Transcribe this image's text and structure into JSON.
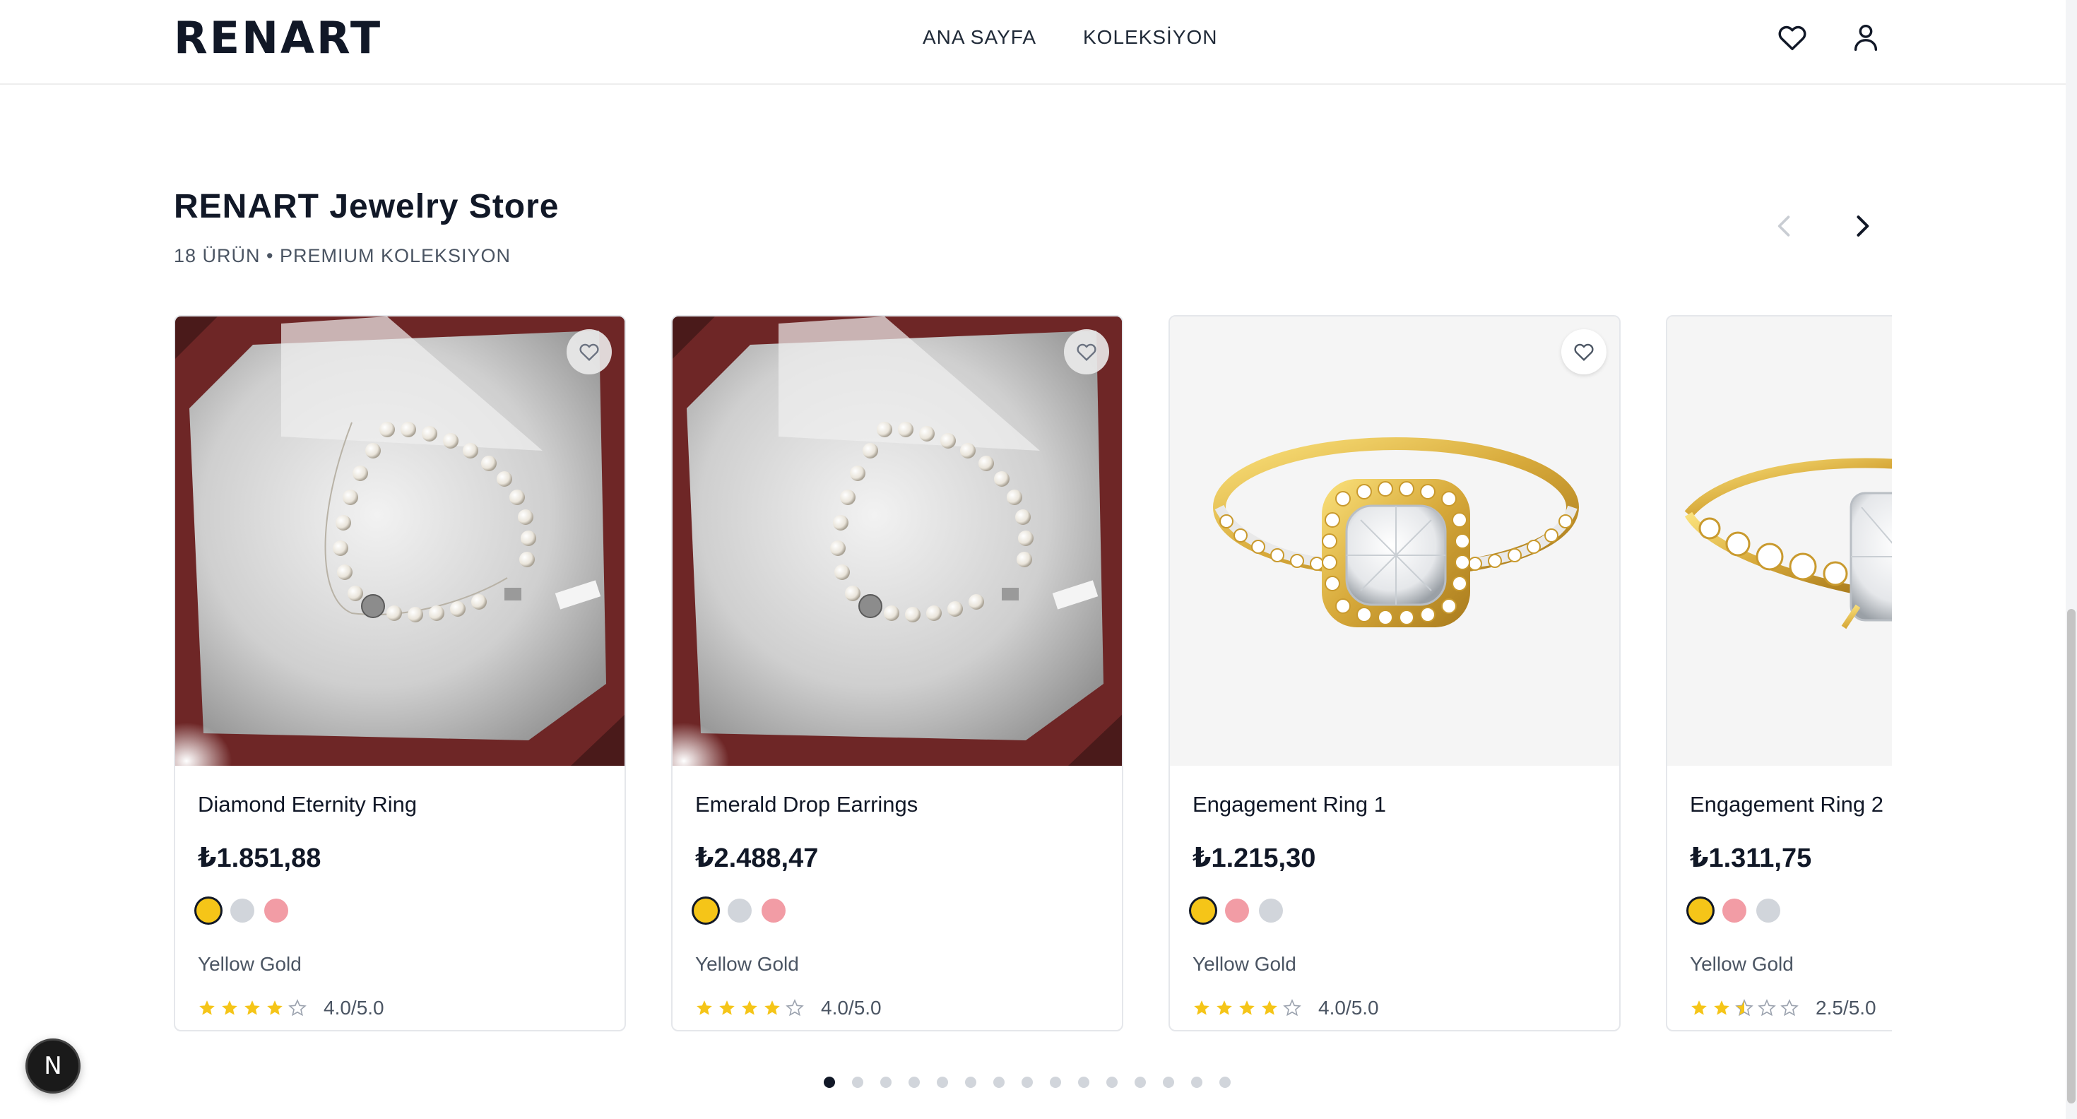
{
  "header": {
    "logo": "RENART",
    "nav": [
      {
        "label": "ANA SAYFA"
      },
      {
        "label": "KOLEKSİYON"
      }
    ],
    "icons": [
      "heart-icon",
      "user-icon"
    ]
  },
  "section": {
    "title": "RENART Jewelry Store",
    "subtitle": "18 ÜRÜN • PREMIUM KOLEKSIYON"
  },
  "products": [
    {
      "name": "Diamond Eternity Ring",
      "price": "₺1.851,88",
      "variant": "Yellow Gold",
      "rating_text": "4.0/5.0",
      "rating": 4.0,
      "swatches": [
        "#f5c518",
        "#d1d5db",
        "#f29ca5"
      ],
      "image": "pearl-necklace"
    },
    {
      "name": "Emerald Drop Earrings",
      "price": "₺2.488,47",
      "variant": "Yellow Gold",
      "rating_text": "4.0/5.0",
      "rating": 4.0,
      "swatches": [
        "#f5c518",
        "#d1d5db",
        "#f29ca5"
      ],
      "image": "pearl-necklace"
    },
    {
      "name": "Engagement Ring 1",
      "price": "₺1.215,30",
      "variant": "Yellow Gold",
      "rating_text": "4.0/5.0",
      "rating": 4.0,
      "swatches": [
        "#f5c518",
        "#f29ca5",
        "#d1d5db"
      ],
      "image": "halo-ring"
    },
    {
      "name": "Engagement Ring 2",
      "price": "₺1.311,75",
      "variant": "Yellow Gold",
      "rating_text": "2.5/5.0",
      "rating": 2.5,
      "swatches": [
        "#f5c518",
        "#f29ca5",
        "#d1d5db"
      ],
      "image": "vintage-ring"
    }
  ],
  "pagination": {
    "total": 15,
    "active": 0
  },
  "badge": {
    "label": "N"
  },
  "colors": {
    "star": "#f5c518",
    "text": "#111827",
    "muted": "#4b5563"
  }
}
